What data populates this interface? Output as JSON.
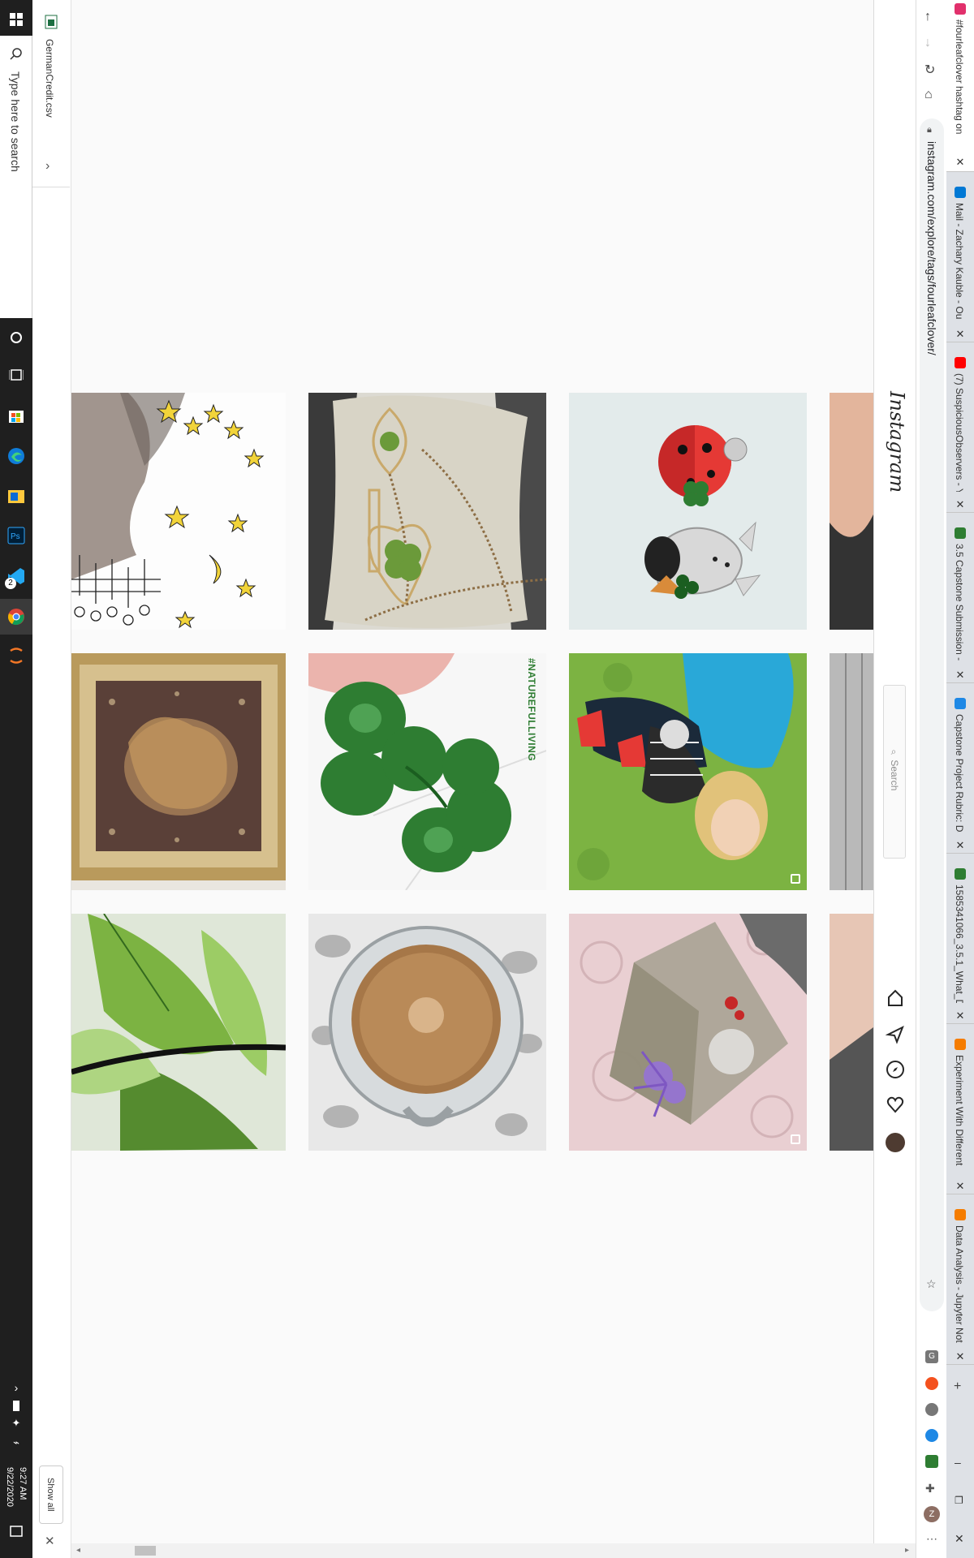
{
  "taskbar": {
    "search_placeholder": "Type here to search",
    "time": "9:27 AM",
    "date": "9/22/2020",
    "badge_count": "2"
  },
  "downloads": {
    "file_name": "GermanCredit.csv",
    "show_all_label": "Show all"
  },
  "browser": {
    "url": "instagram.com/explore/tags/fourleafclover/",
    "tabs": [
      {
        "title": "#fourleafclover hashtag on",
        "color": "#e1306c"
      },
      {
        "title": "Mail - Zachary Kauble - Ou",
        "color": "#0078d4"
      },
      {
        "title": "(7) SuspiciousObservers - Yo",
        "color": "#ff0000"
      },
      {
        "title": "3.5 Capstone Submission -",
        "color": "#2e7d32"
      },
      {
        "title": "Capstone Project Rubric: Da",
        "color": "#1e88e5"
      },
      {
        "title": "1585341066_3.5.1_What_Da",
        "color": "#2e7d32"
      },
      {
        "title": "Experiment With Different",
        "color": "#f57c00"
      },
      {
        "title": "Data Analysis - Jupyter Not",
        "color": "#f57c00"
      }
    ]
  },
  "instagram": {
    "logo": "Instagram",
    "search_placeholder": "Search",
    "grid": [
      {
        "name": "drawing-stars",
        "multi": false
      },
      {
        "name": "clover-necklaces",
        "multi": false
      },
      {
        "name": "ladybug-pins",
        "multi": false
      },
      {
        "name": "framed-artwork",
        "multi": false
      },
      {
        "name": "four-leaf-clover",
        "multi": false,
        "watermark": "#NATUREFULLIVING"
      },
      {
        "name": "child-on-grass",
        "multi": true
      },
      {
        "name": "green-leaves",
        "multi": false
      },
      {
        "name": "coffee-cup",
        "multi": false
      },
      {
        "name": "resin-cube",
        "multi": true
      }
    ]
  },
  "colors": {
    "taskbar": "#1f1f1f",
    "page_bg": "#fafafa",
    "tabstrip": "#dee1e6"
  }
}
